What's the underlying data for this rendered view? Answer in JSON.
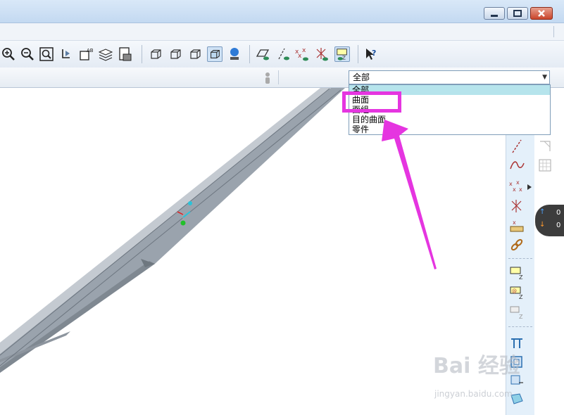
{
  "filter": {
    "selected": "全部",
    "options": [
      "全部",
      "曲面",
      "面组",
      "目的曲面",
      "零件"
    ]
  },
  "sidebar_status": {
    "up_value": "0",
    "down_value": "0"
  },
  "watermark": {
    "brand": "Bai 经验",
    "url": "jingyan.baidu.com"
  },
  "colors": {
    "highlight": "#e535e0",
    "selected_option": "#b6e4ec",
    "model": "#9aa3ad"
  }
}
